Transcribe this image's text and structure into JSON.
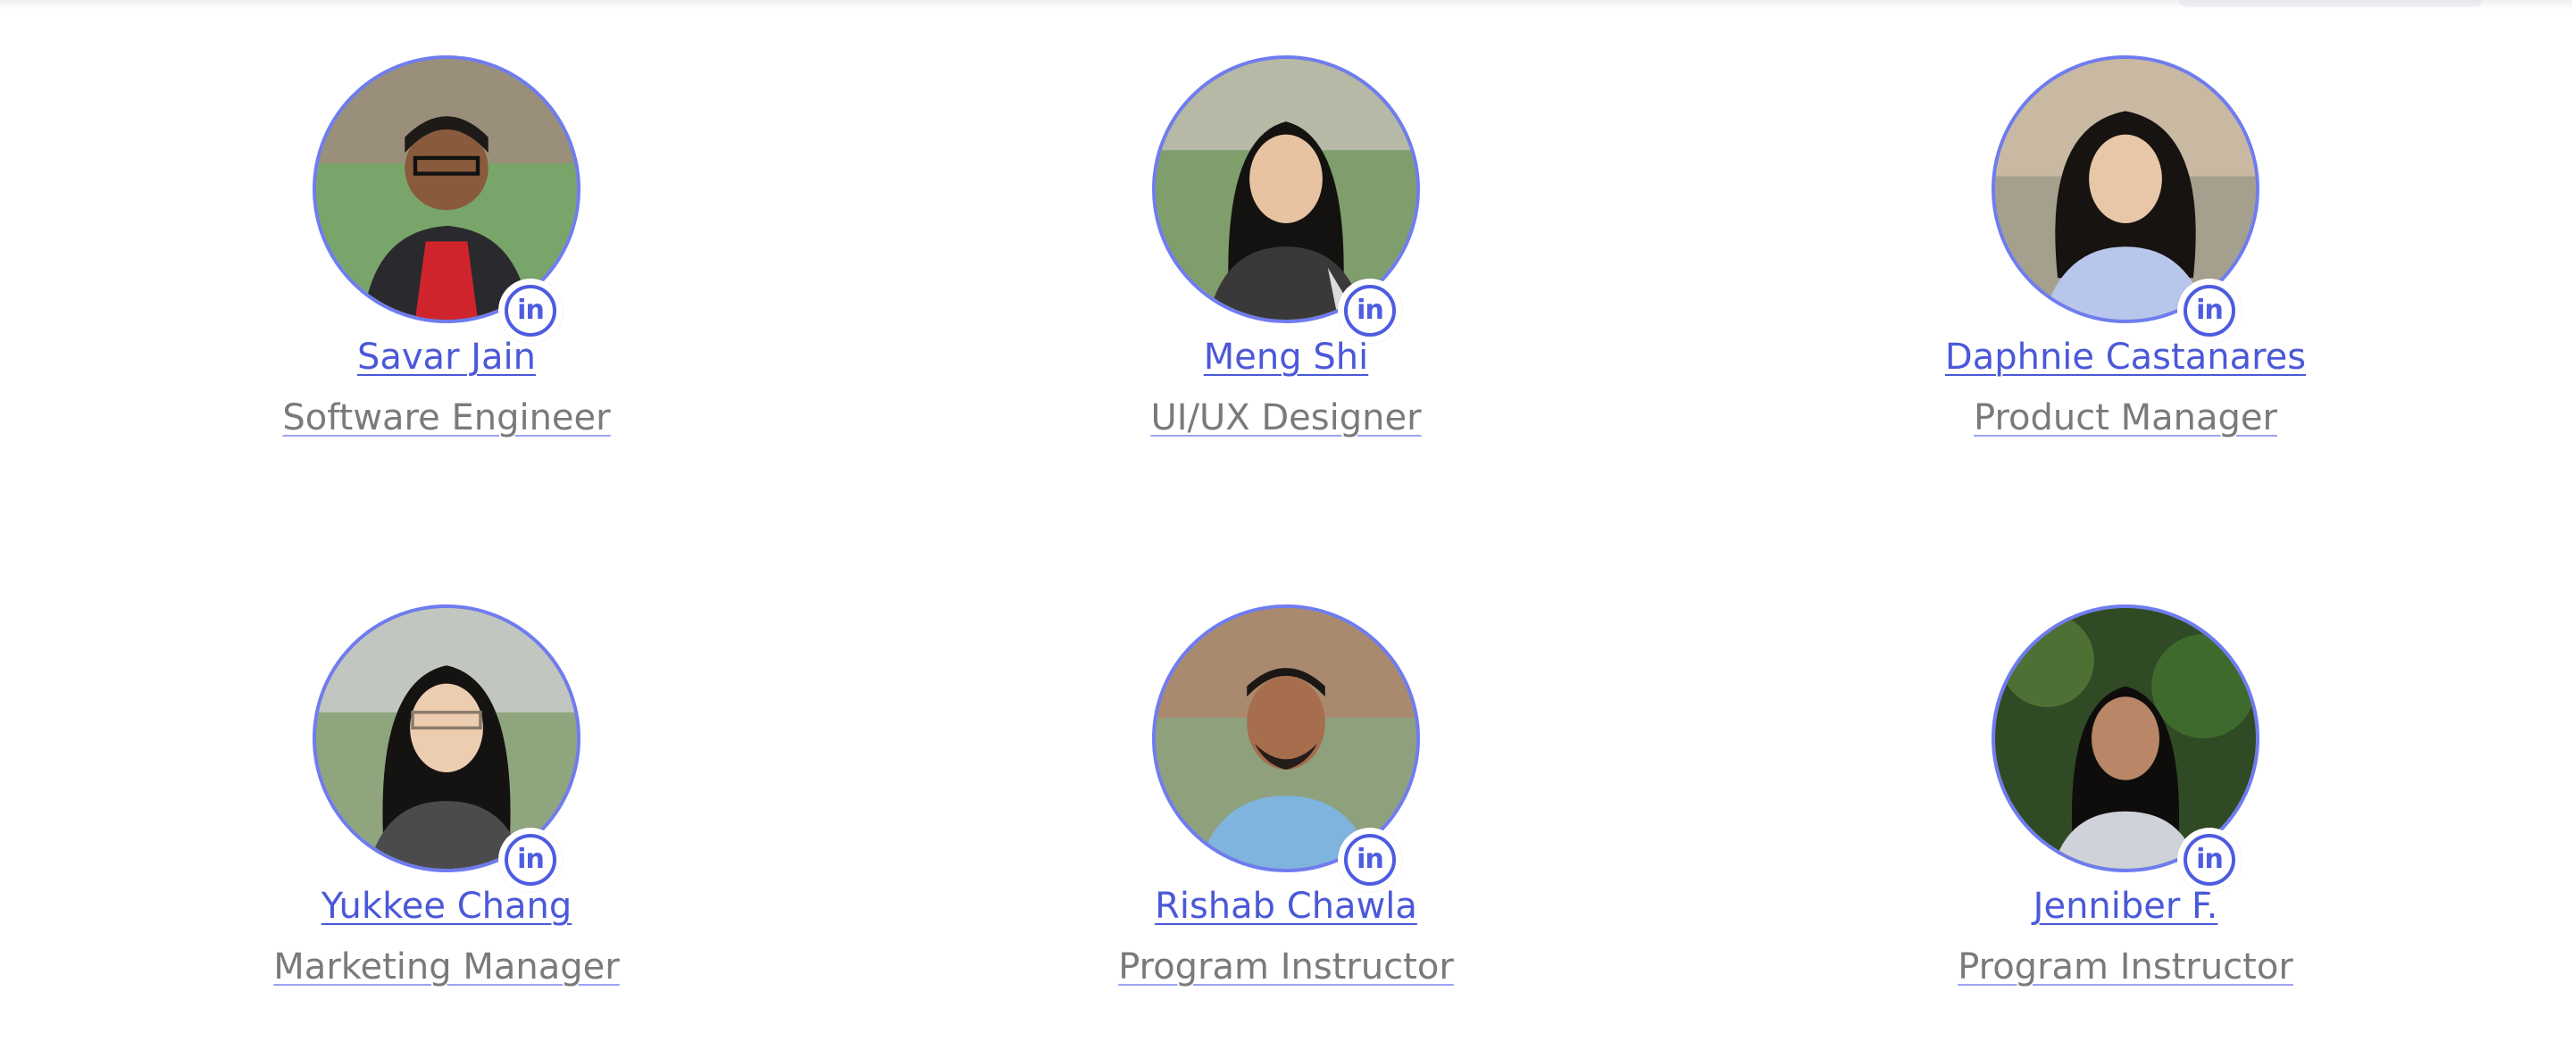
{
  "team": [
    {
      "name": "Savar Jain",
      "role": "Software Engineer",
      "photo": "portrait-photo",
      "linkedin_icon": "linkedin-icon",
      "linkedin_text": "in"
    },
    {
      "name": "Meng Shi",
      "role": "UI/UX Designer",
      "photo": "portrait-photo",
      "linkedin_icon": "linkedin-icon",
      "linkedin_text": "in"
    },
    {
      "name": "Daphnie Castanares",
      "role": "Product Manager",
      "photo": "portrait-photo",
      "linkedin_icon": "linkedin-icon",
      "linkedin_text": "in"
    },
    {
      "name": "Yukkee Chang",
      "role": "Marketing Manager",
      "photo": "portrait-photo",
      "linkedin_icon": "linkedin-icon",
      "linkedin_text": "in"
    },
    {
      "name": "Rishab Chawla",
      "role": "Program Instructor",
      "photo": "portrait-photo",
      "linkedin_icon": "linkedin-icon",
      "linkedin_text": "in"
    },
    {
      "name": "Jenniber F.",
      "role": "Program Instructor",
      "photo": "portrait-photo",
      "linkedin_icon": "linkedin-icon",
      "linkedin_text": "in"
    }
  ],
  "colors": {
    "link": "#4b58d8",
    "role_text": "#7a7a7a",
    "avatar_ring": "#6f7cf0",
    "linkedin_accent": "#4d5ce0"
  }
}
